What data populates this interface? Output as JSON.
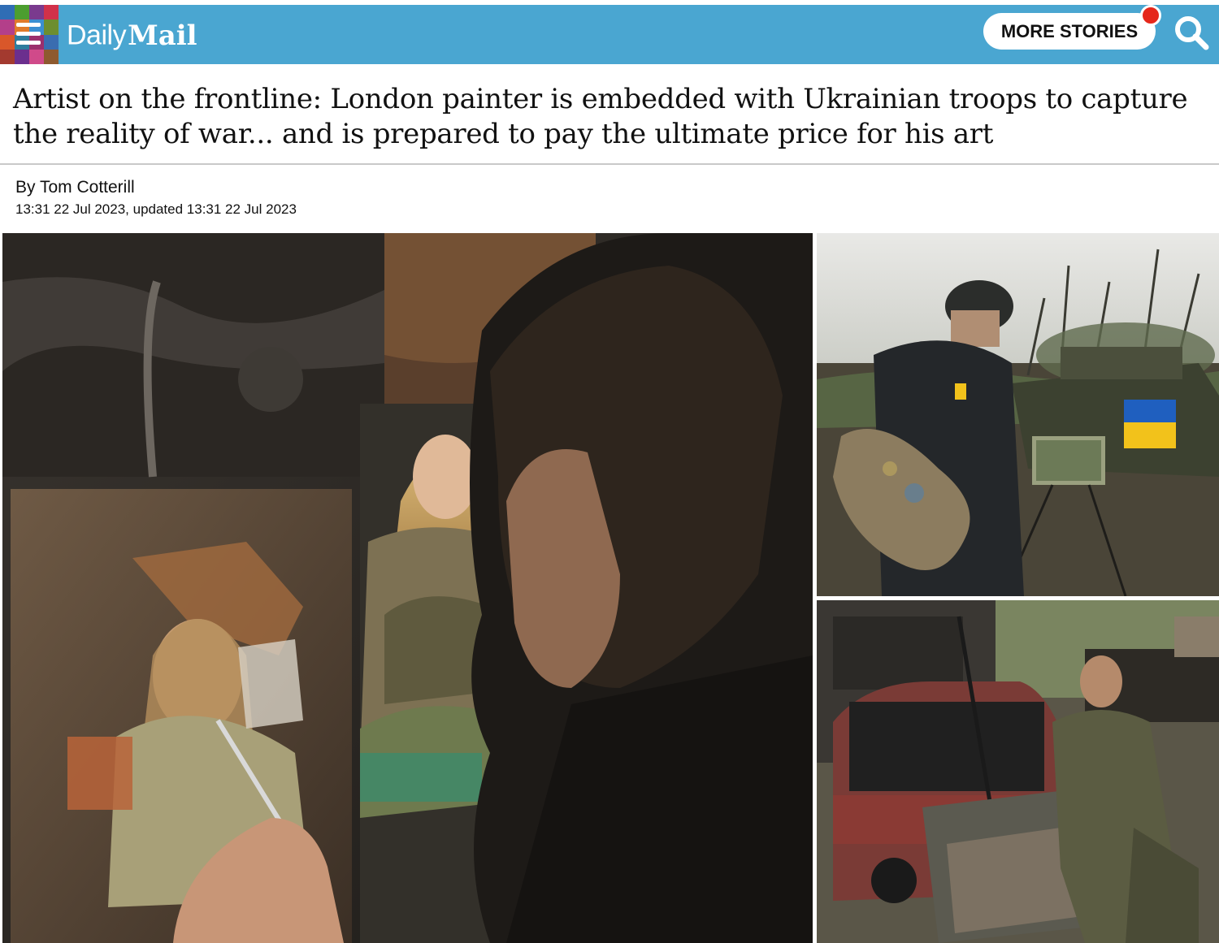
{
  "header": {
    "logo_daily": "Daily",
    "logo_mail": "Mail",
    "more_stories_label": "MORE STORIES",
    "brand_color": "#4aa6d1",
    "notification_color": "#e5271b",
    "menu_icon": "hamburger-menu-icon",
    "search_icon": "search-icon"
  },
  "article": {
    "headline": "Artist on the frontline: London painter is embedded with Ukrainian troops to capture the reality of war... and is prepared to pay the ultimate price for his art",
    "byline": "By Tom Cotterill",
    "dateline": "13:31 22 Jul 2023, updated 13:31 22 Jul 2023"
  }
}
